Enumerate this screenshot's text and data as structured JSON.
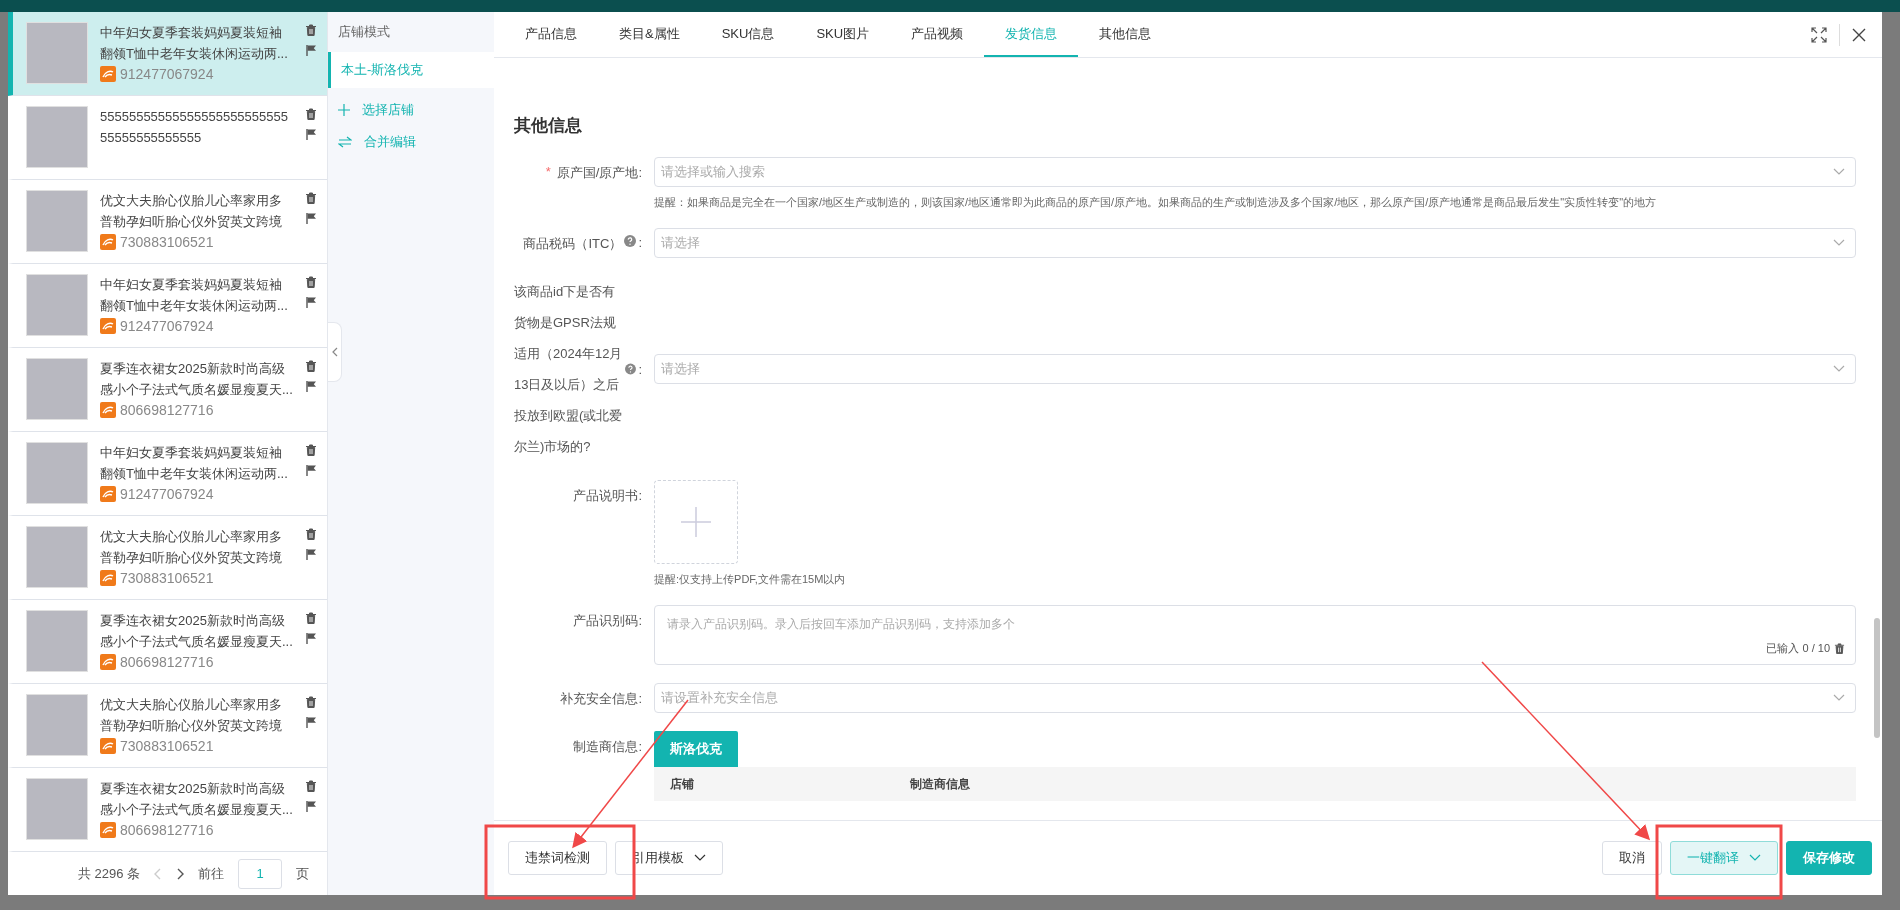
{
  "product_list": {
    "items": [
      {
        "title": "中年妇女夏季套装妈妈夏装短袖翻领T恤中老年女装休闲运动两...",
        "id": "912477067924",
        "selected": true
      },
      {
        "title": "5555555555555555555555555555555555555555",
        "selected": false
      },
      {
        "title": "优文大夫胎心仪胎儿心率家用多普勒孕妇听胎心仪外贸英文跨境",
        "id": "730883106521",
        "selected": false
      },
      {
        "title": "中年妇女夏季套装妈妈夏装短袖翻领T恤中老年女装休闲运动两...",
        "id": "912477067924",
        "selected": false
      },
      {
        "title": "夏季连衣裙女2025新款时尚高级感小个子法式气质名媛显瘦夏天...",
        "id": "806698127716",
        "selected": false
      },
      {
        "title": "中年妇女夏季套装妈妈夏装短袖翻领T恤中老年女装休闲运动两...",
        "id": "912477067924",
        "selected": false
      },
      {
        "title": "优文大夫胎心仪胎儿心率家用多普勒孕妇听胎心仪外贸英文跨境",
        "id": "730883106521",
        "selected": false
      },
      {
        "title": "夏季连衣裙女2025新款时尚高级感小个子法式气质名媛显瘦夏天...",
        "id": "806698127716",
        "selected": false
      },
      {
        "title": "优文大夫胎心仪胎儿心率家用多普勒孕妇听胎心仪外贸英文跨境",
        "id": "730883106521",
        "selected": false
      },
      {
        "title": "夏季连衣裙女2025新款时尚高级感小个子法式气质名媛显瘦夏天...",
        "id": "806698127716",
        "selected": false
      }
    ],
    "pager": {
      "total": "共 2296 条",
      "goto": "前往",
      "page": "1",
      "unit": "页"
    }
  },
  "shop_panel": {
    "header": "店铺模式",
    "shops": [
      {
        "label": "本土-斯洛伐克",
        "selected": true
      }
    ],
    "actions": [
      {
        "kind": "add",
        "label": "选择店铺"
      },
      {
        "kind": "merge",
        "label": "合并编辑"
      }
    ]
  },
  "tabs": [
    {
      "label": "产品信息",
      "selected": false
    },
    {
      "label": "类目&属性",
      "selected": false
    },
    {
      "label": "SKU信息",
      "selected": false
    },
    {
      "label": "SKU图片",
      "selected": false
    },
    {
      "label": "产品视频",
      "selected": false
    },
    {
      "label": "发货信息",
      "selected": true
    },
    {
      "label": "其他信息",
      "selected": false
    }
  ],
  "section_title": "其他信息",
  "fields": [
    {
      "kind": "select",
      "mark": "*",
      "label": "原产国/原产地:",
      "help": false,
      "placeholder": "请选择或输入搜索",
      "hint": "提醒：如果商品是完全在一个国家/地区生产或制造的，则该国家/地区通常即为此商品的原产国/原产地。如果商品的生产或制造涉及多个国家/地区，那么原产国/原产地通常是商品最后发生\"实质性转变\"的地方"
    },
    {
      "kind": "select",
      "label": "商品税码（ITC）",
      "help": true,
      "suffix": ":",
      "placeholder": "请选择"
    },
    {
      "kind": "select",
      "label": "该商品id下是否有货物是GPSR法规适用（2024年12月13日及以后）之后投放到欧盟(或北爱尔兰)市场的?",
      "help": true,
      "suffix": ":",
      "placeholder": "请选择",
      "long": true
    },
    {
      "kind": "upload",
      "label": "产品说明书:",
      "help": false,
      "hint": "提醒:仅支持上传PDF,文件需在15M以内"
    },
    {
      "kind": "textarea",
      "label": "产品识别码:",
      "help": false,
      "placeholder": "请录入产品识别码。录入后按回车添加产品识别码，支持添加多个",
      "counter": "已输入 0 / 10"
    },
    {
      "kind": "select",
      "label": "补充安全信息:",
      "help": false,
      "placeholder": "请设置补充安全信息"
    },
    {
      "kind": "manufacturer",
      "label": "制造商信息:",
      "help": false,
      "tabs": [
        {
          "label": "斯洛伐克",
          "selected": true
        }
      ],
      "columns": [
        "店铺",
        "制造商信息"
      ]
    }
  ],
  "footer": {
    "left": [
      {
        "label": "违禁词检测",
        "dropdown": false
      },
      {
        "label": "引用模板",
        "dropdown": true
      }
    ],
    "right": [
      {
        "label": "取消",
        "kind": "default",
        "dropdown": false
      },
      {
        "label": "一键翻译",
        "kind": "light",
        "dropdown": true
      },
      {
        "label": "保存修改",
        "kind": "primary",
        "dropdown": false
      }
    ]
  }
}
